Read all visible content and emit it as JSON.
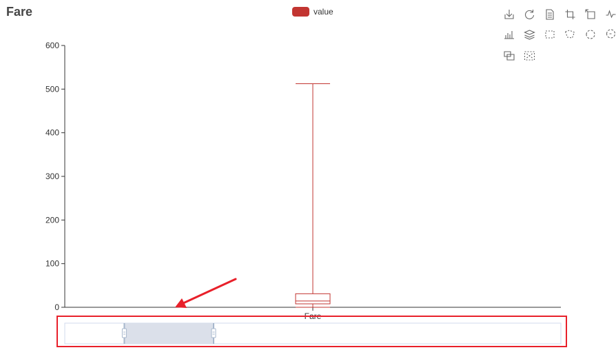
{
  "chart_data": {
    "type": "boxplot",
    "title": "Fare",
    "legend": [
      {
        "name": "value",
        "color": "#c23531"
      }
    ],
    "legend_position": "top-center",
    "categories": [
      "Fare"
    ],
    "series": [
      {
        "name": "value",
        "color": "#c23531",
        "boxes": [
          {
            "category": "Fare",
            "min": 0,
            "q1": 7.9,
            "median": 14.45,
            "q3": 31,
            "max": 512.33
          }
        ]
      }
    ],
    "y_ticks": [
      0,
      100,
      200,
      300,
      400,
      500,
      600
    ],
    "ylim": [
      0,
      600
    ],
    "xlabel": "",
    "ylabel": "",
    "grid": false,
    "data_zoom": {
      "start_percent": 12,
      "end_percent": 30
    }
  },
  "toolbox": {
    "position": "top-right",
    "icons": [
      "download-icon",
      "refresh-icon",
      "data-view-icon",
      "zoom-icon",
      "zoom-reset-icon",
      "line-chart-icon",
      "bar-chart-icon",
      "stack-icon",
      "rect-select-icon",
      "polygon-select-icon",
      "keep-select-icon",
      "clear-select-icon",
      "dataset-icon",
      "clear-icon"
    ]
  },
  "annotation": {
    "arrow_color": "#e8202a",
    "highlight_color": "#e8202a",
    "target": "data-zoom-slider"
  },
  "colors": {
    "axis": "#333333",
    "slider_border": "#d2dbee",
    "slider_fill": "#d7dde8",
    "slider_handle": "#a7b7cc"
  }
}
